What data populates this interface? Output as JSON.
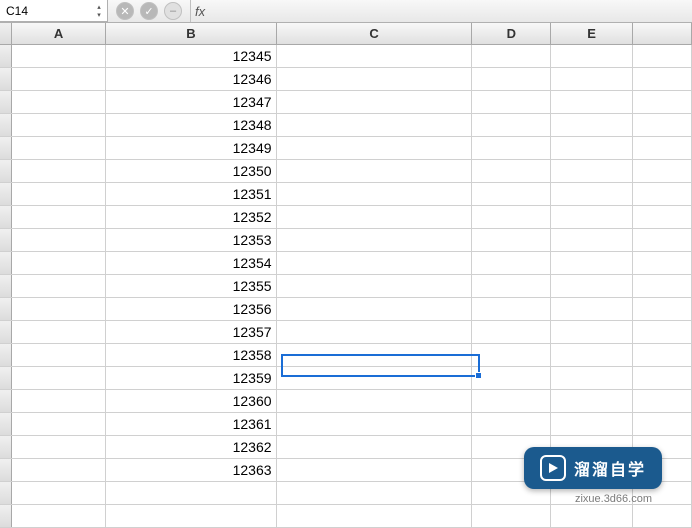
{
  "formula_bar": {
    "cell_ref": "C14",
    "fx_label": "fx",
    "formula_value": ""
  },
  "columns": [
    "A",
    "B",
    "C",
    "D",
    "E"
  ],
  "column_widths": {
    "A": 96,
    "B": 173,
    "C": 199,
    "D": 80,
    "E": 83
  },
  "rows_visible": 21,
  "selected_cell": "C14",
  "data": {
    "B": [
      "12345",
      "12346",
      "12347",
      "12348",
      "12349",
      "12350",
      "12351",
      "12352",
      "12353",
      "12354",
      "12355",
      "12356",
      "12357",
      "12358",
      "12359",
      "12360",
      "12361",
      "12362",
      "12363",
      "",
      ""
    ]
  },
  "watermark": {
    "brand": "溜溜自学",
    "url": "zixue.3d66.com"
  },
  "chart_data": {
    "type": "table",
    "columns": [
      "A",
      "B",
      "C",
      "D",
      "E"
    ],
    "rows": [
      {
        "B": 12345
      },
      {
        "B": 12346
      },
      {
        "B": 12347
      },
      {
        "B": 12348
      },
      {
        "B": 12349
      },
      {
        "B": 12350
      },
      {
        "B": 12351
      },
      {
        "B": 12352
      },
      {
        "B": 12353
      },
      {
        "B": 12354
      },
      {
        "B": 12355
      },
      {
        "B": 12356
      },
      {
        "B": 12357
      },
      {
        "B": 12358
      },
      {
        "B": 12359
      },
      {
        "B": 12360
      },
      {
        "B": 12361
      },
      {
        "B": 12362
      },
      {
        "B": 12363
      }
    ]
  }
}
